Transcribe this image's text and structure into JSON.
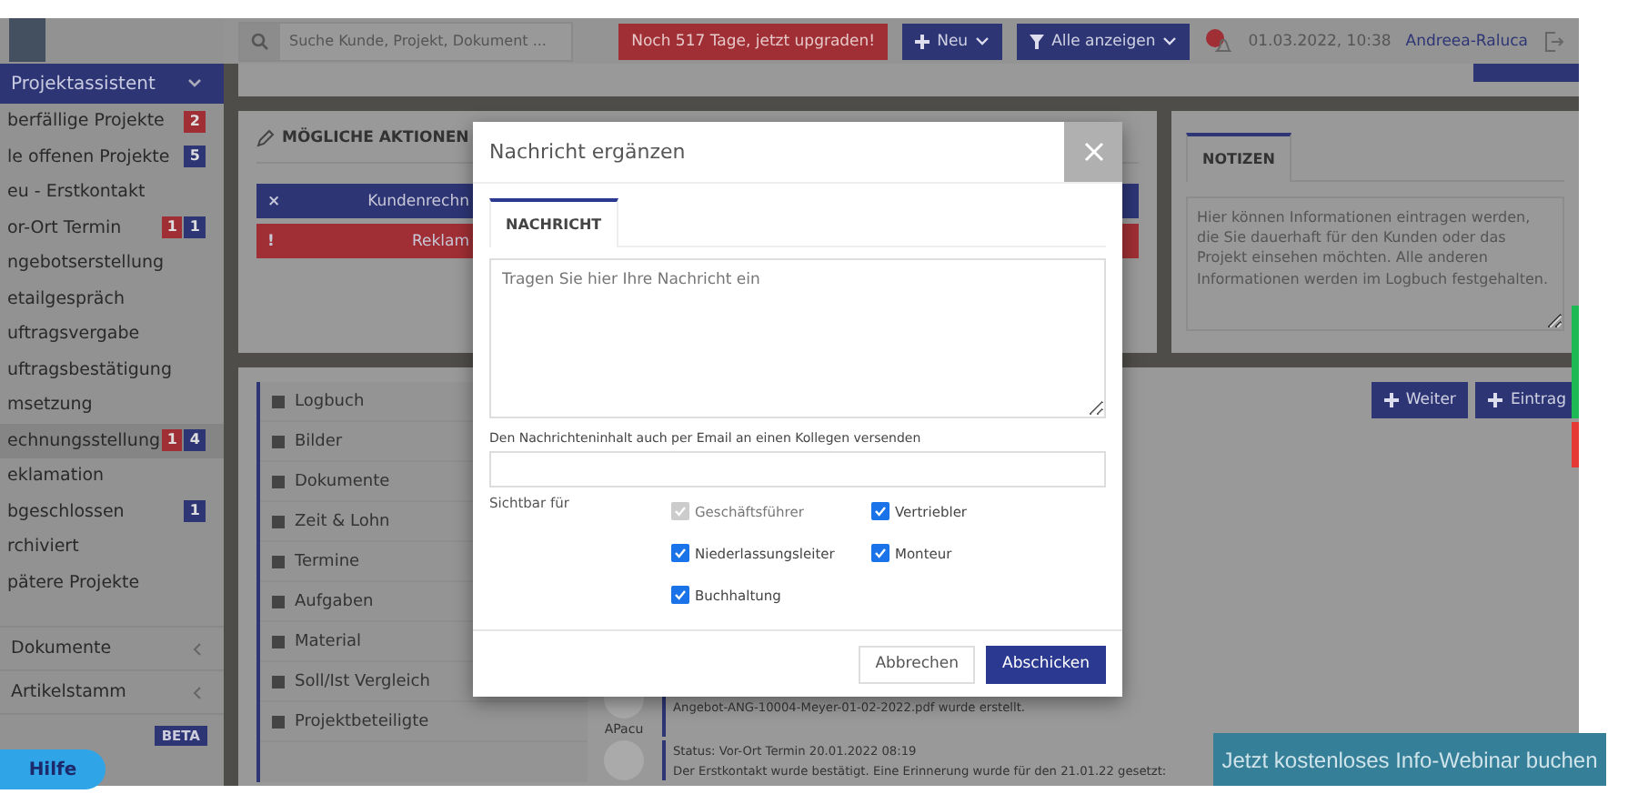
{
  "topbar": {
    "search": {
      "placeholder": "Suche Kunde, Projekt, Dokument ..."
    },
    "upgrade_button": "Noch 517 Tage, jetzt upgraden!",
    "new_button": "Neu",
    "filter_button": "Alle anzeigen",
    "datetime": "01.03.2022, 10:38",
    "user": "Andreea-Raluca"
  },
  "sidebar": {
    "header": "Projektassistent",
    "items": [
      {
        "label": "berfällige Projekte",
        "selected": false,
        "badges": [
          {
            "text": "2",
            "color": "#a02f35"
          }
        ]
      },
      {
        "label": "le offenen Projekte",
        "selected": false,
        "badges": [
          {
            "text": "5",
            "color": "#2d3575"
          }
        ]
      },
      {
        "label": "eu - Erstkontakt",
        "selected": false
      },
      {
        "label": "or-Ort Termin",
        "selected": false,
        "badges": [
          {
            "text": "1",
            "color": "#a02f35"
          },
          {
            "text": "1",
            "color": "#2d3575"
          }
        ]
      },
      {
        "label": "ngebotserstellung",
        "selected": false
      },
      {
        "label": "etailgespräch",
        "selected": false
      },
      {
        "label": "uftragsvergabe",
        "selected": false
      },
      {
        "label": "uftragsbestätigung",
        "selected": false
      },
      {
        "label": "msetzung",
        "selected": false
      },
      {
        "label": "echnungsstellung",
        "selected": true,
        "badges": [
          {
            "text": "1",
            "color": "#a02f35"
          },
          {
            "text": "4",
            "color": "#2d3575"
          }
        ]
      },
      {
        "label": "eklamation",
        "selected": false
      },
      {
        "label": "bgeschlossen",
        "selected": false,
        "badges": [
          {
            "text": "1",
            "color": "#2d3575"
          }
        ]
      },
      {
        "label": "rchiviert",
        "selected": false
      },
      {
        "label": "pätere Projekte",
        "selected": false
      }
    ],
    "sections": [
      {
        "label": "Dokumente",
        "kind": "expandable"
      },
      {
        "label": "Artikelstamm",
        "kind": "expandable"
      },
      {
        "badge": "BETA",
        "kind": "beta"
      }
    ]
  },
  "actions_panel": {
    "title": "MÖGLICHE AKTIONEN",
    "buttons": [
      {
        "label": "Kundenrechn",
        "icon": "×",
        "color": "#2d3575"
      },
      {
        "label": "Reklam",
        "icon": "!",
        "color": "#a02f35"
      }
    ]
  },
  "notes_panel": {
    "tab": "NOTIZEN",
    "placeholder": "Hier können Informationen eintragen werden, die Sie dauerhaft für den Kunden oder das Projekt einsehen möchten. Alle anderen Informationen werden im Logbuch festgehalten."
  },
  "log_menu": [
    "Logbuch",
    "Bilder",
    "Dokumente",
    "Zeit & Lohn",
    "Termine",
    "Aufgaben",
    "Material",
    "Soll/Ist Vergleich",
    "Projektbeteiligte"
  ],
  "log_buttons": [
    "Weiter",
    "Eintrag"
  ],
  "log_entries": [
    {
      "author": "APacu",
      "lines": [
        "Angebot-ANG-10004-Meyer-01-02-2022.pdf wurde erstellt."
      ]
    },
    {
      "lines": [
        "Status: Vor-Ort Termin 20.01.2022 08:19",
        "Der Erstkontakt wurde bestätigt. Eine Erinnerung wurde für den 21.01.22 gesetzt:"
      ]
    }
  ],
  "help_button": "Hilfe",
  "webinar_banner": "Jetzt kostenloses Info-Webinar buchen",
  "modal": {
    "title": "Nachricht ergänzen",
    "tab": "NACHRICHT",
    "message_placeholder": "Tragen Sie hier Ihre Nachricht ein",
    "email_label": "Den Nachrichteninhalt auch per Email an einen Kollegen versenden",
    "visible_label": "Sichtbar für",
    "recipients": [
      {
        "label": "Geschäftsführer",
        "checked": true,
        "disabled": true
      },
      {
        "label": "Vertriebler",
        "checked": true,
        "disabled": false
      },
      {
        "label": "Niederlassungsleiter",
        "checked": true,
        "disabled": false
      },
      {
        "label": "Monteur",
        "checked": true,
        "disabled": false
      },
      {
        "label": "Buchhaltung",
        "checked": true,
        "disabled": false
      }
    ],
    "buttons": [
      {
        "label": "Abbrechen",
        "kind": "secondary"
      },
      {
        "label": "Abschicken",
        "kind": "primary"
      }
    ]
  }
}
